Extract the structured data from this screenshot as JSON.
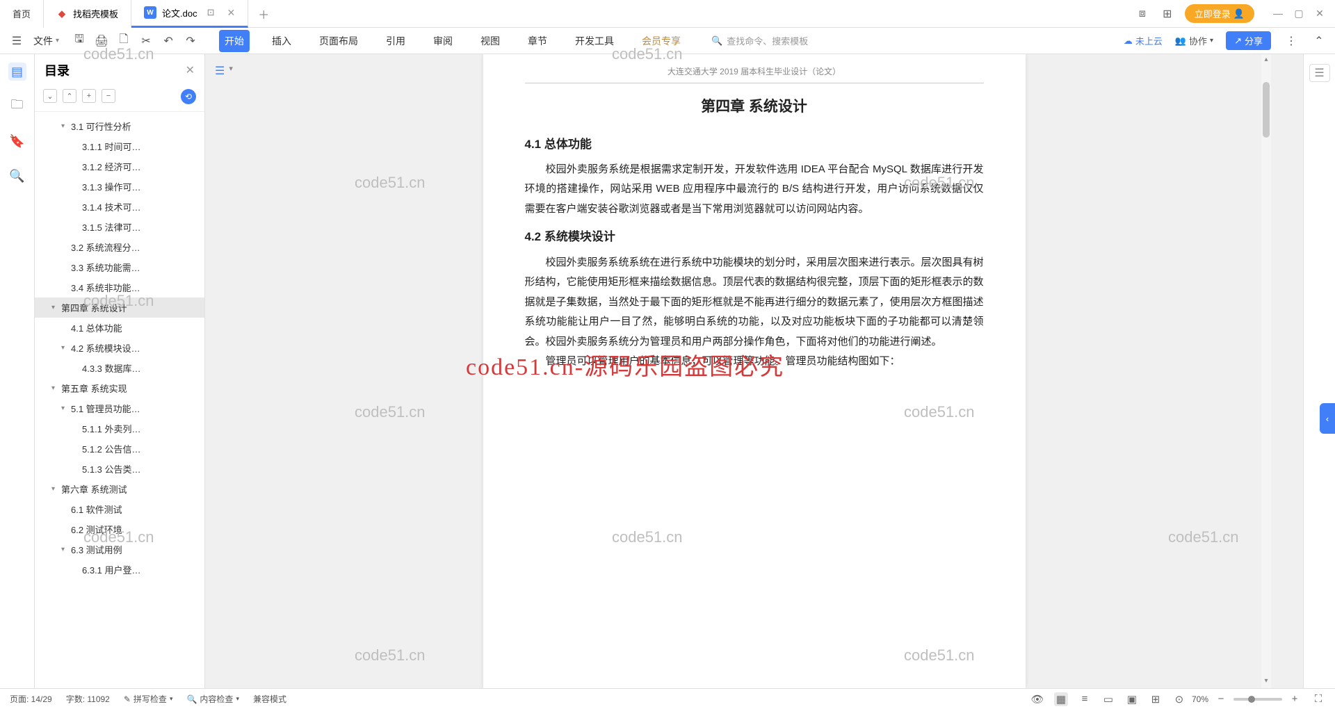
{
  "tabs": {
    "home": "首页",
    "template": "找稻壳模板",
    "doc": "论文.doc"
  },
  "login_btn": "立即登录",
  "ribbon": {
    "file": "文件",
    "menus": [
      "开始",
      "插入",
      "页面布局",
      "引用",
      "审阅",
      "视图",
      "章节",
      "开发工具",
      "会员专享"
    ],
    "search_placeholder": "查找命令、搜索模板",
    "not_cloud": "未上云",
    "collab": "协作",
    "share": "分享"
  },
  "outline": {
    "title": "目录",
    "items": [
      {
        "text": "3.1 可行性分析",
        "pad": 2,
        "arrow": "v"
      },
      {
        "text": "3.1.1 时间可…",
        "pad": 3
      },
      {
        "text": "3.1.2 经济可…",
        "pad": 3
      },
      {
        "text": "3.1.3 操作可…",
        "pad": 3
      },
      {
        "text": "3.1.4 技术可…",
        "pad": 3
      },
      {
        "text": "3.1.5 法律可…",
        "pad": 3
      },
      {
        "text": "3.2 系统流程分…",
        "pad": 2
      },
      {
        "text": "3.3 系统功能需…",
        "pad": 2
      },
      {
        "text": "3.4 系统非功能…",
        "pad": 2
      },
      {
        "text": "第四章  系统设计",
        "pad": 1,
        "arrow": "v",
        "selected": true
      },
      {
        "text": "4.1 总体功能",
        "pad": 2
      },
      {
        "text": "4.2 系统模块设…",
        "pad": 2,
        "arrow": "v"
      },
      {
        "text": "4.3.3 数据库…",
        "pad": 3
      },
      {
        "text": "第五章  系统实现",
        "pad": 1,
        "arrow": "v"
      },
      {
        "text": "5.1 管理员功能…",
        "pad": 2,
        "arrow": "v"
      },
      {
        "text": "5.1.1 外卖列…",
        "pad": 3
      },
      {
        "text": "5.1.2 公告信…",
        "pad": 3
      },
      {
        "text": "5.1.3 公告类…",
        "pad": 3
      },
      {
        "text": "第六章  系统测试",
        "pad": 1,
        "arrow": "v"
      },
      {
        "text": "6.1 软件测试",
        "pad": 2
      },
      {
        "text": "6.2 测试环境",
        "pad": 2
      },
      {
        "text": "6.3 测试用例",
        "pad": 2,
        "arrow": "v"
      },
      {
        "text": "6.3.1 用户登…",
        "pad": 3
      }
    ]
  },
  "doc": {
    "header": "大连交通大学 2019 届本科生毕业设计（论文）",
    "chapter": "第四章  系统设计",
    "sec1_title": "4.1  总体功能",
    "sec1_p": "校园外卖服务系统是根据需求定制开发，开发软件选用 IDEA 平台配合 MySQL 数据库进行开发环境的搭建操作，网站采用 WEB 应用程序中最流行的 B/S 结构进行开发，用户访问系统数据仅仅需要在客户端安装谷歌浏览器或者是当下常用浏览器就可以访问网站内容。",
    "sec2_title": "4.2  系统模块设计",
    "sec2_p1": "校园外卖服务系统系统在进行系统中功能模块的划分时，采用层次图来进行表示。层次图具有树形结构，它能使用矩形框来描绘数据信息。顶层代表的数据结构很完整，顶层下面的矩形框表示的数据就是子集数据，当然处于最下面的矩形框就是不能再进行细分的数据元素了，使用层次方框图描述系统功能能让用户一目了然，能够明白系统的功能，以及对应功能板块下面的子功能都可以清楚领会。校园外卖服务系统分为管理员和用户两部分操作角色，下面将对他们的功能进行阐述。",
    "sec2_p2": "管理员可以管理用户的基本信息，可以管理等功能。管理员功能结构图如下："
  },
  "status": {
    "page": "页面: 14/29",
    "words": "字数: 11092",
    "spell": "拼写检查",
    "content": "内容检查",
    "compat": "兼容模式",
    "zoom": "70%"
  },
  "watermark": "code51.cn",
  "watermark_red": "code51.cn-源码乐园盗图必究"
}
